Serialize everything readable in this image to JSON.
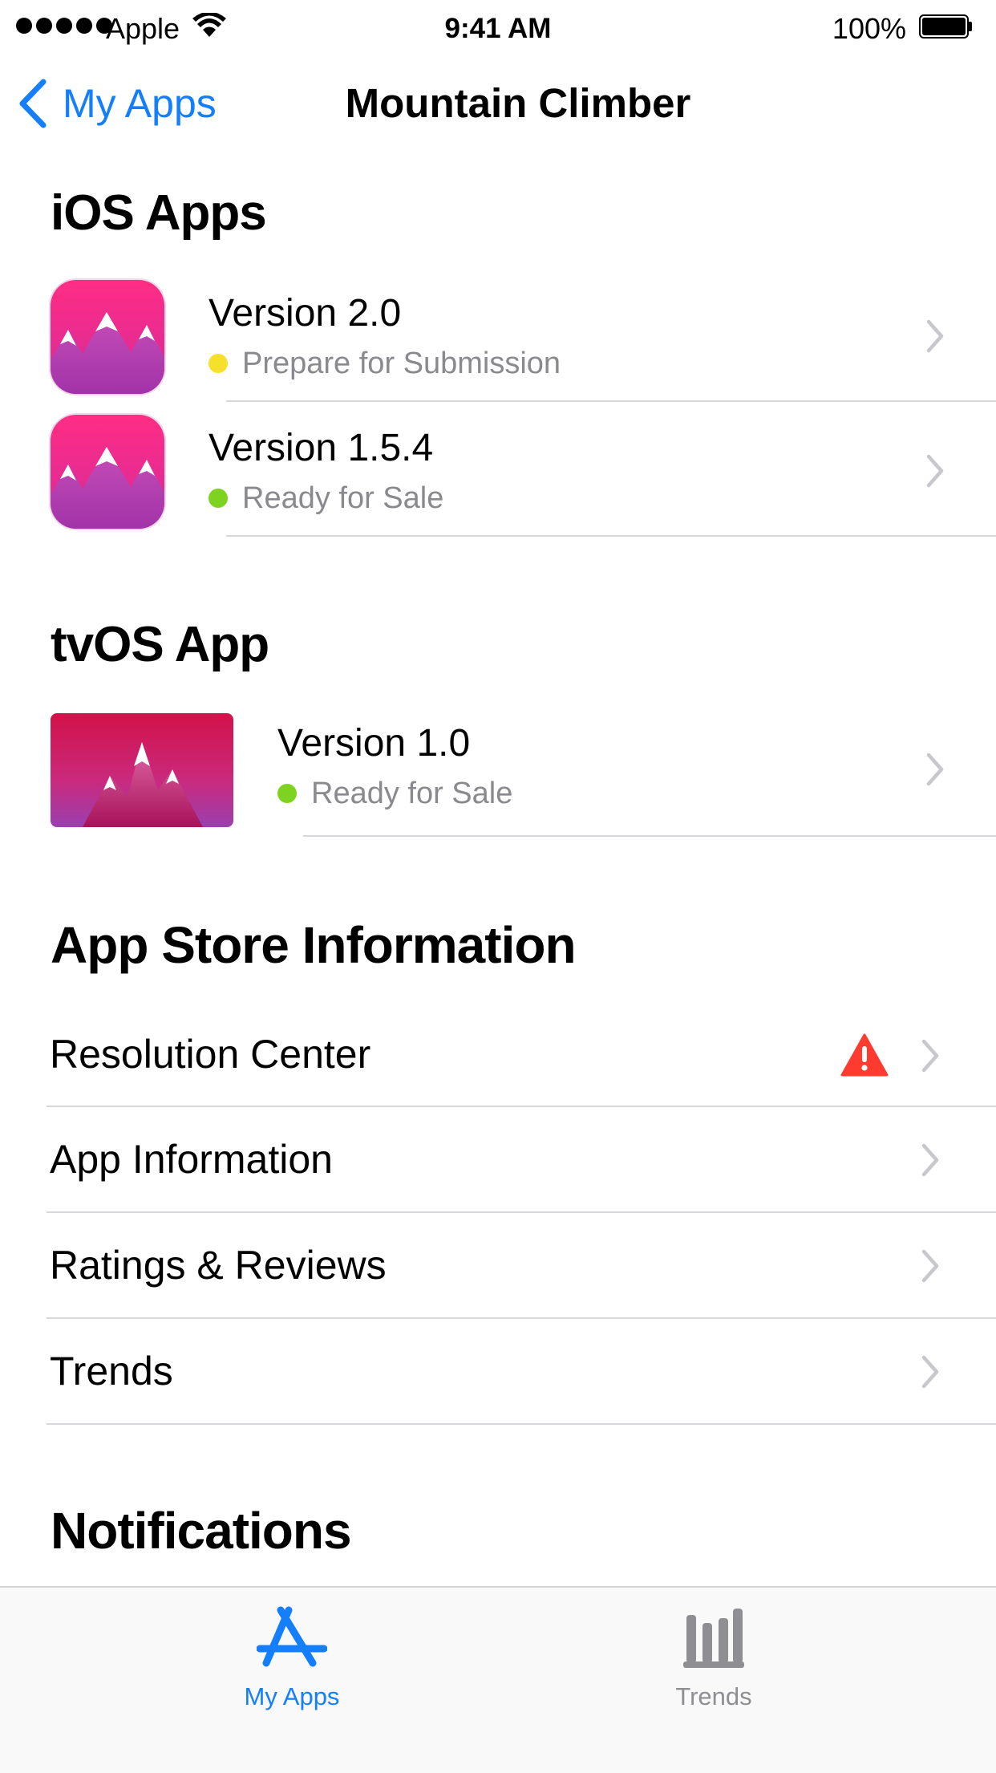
{
  "status_bar": {
    "carrier": "Apple",
    "time": "9:41 AM",
    "battery": "100%",
    "signal_icon": "signal-dots-icon",
    "wifi_icon": "wifi-icon",
    "battery_icon": "battery-icon"
  },
  "nav": {
    "back_label": "My Apps",
    "title": "Mountain Climber",
    "accent_color": "#147efb"
  },
  "ios_section": {
    "heading": "iOS Apps",
    "items": [
      {
        "version": "Version 2.0",
        "status": "Prepare for Submission",
        "status_color": "#f7e02b"
      },
      {
        "version": "Version 1.5.4",
        "status": "Ready for Sale",
        "status_color": "#7ed321"
      }
    ]
  },
  "tvos_section": {
    "heading": "tvOS App",
    "items": [
      {
        "version": "Version 1.0",
        "status": "Ready for Sale",
        "status_color": "#7ed321"
      }
    ]
  },
  "store_section": {
    "heading": "App Store Information",
    "items": [
      {
        "label": "Resolution Center",
        "alert": true,
        "alert_icon": "warning-icon",
        "alert_color": "#ff3b30"
      },
      {
        "label": "App Information"
      },
      {
        "label": "Ratings & Reviews"
      },
      {
        "label": "Trends"
      }
    ]
  },
  "notifications_section": {
    "heading": "Notifications"
  },
  "tabbar": {
    "tabs": [
      {
        "label": "My Apps",
        "icon": "app-store-icon",
        "active": true,
        "color": "#147efb"
      },
      {
        "label": "Trends",
        "icon": "bar-chart-icon",
        "active": false,
        "color": "#8e8e93"
      }
    ]
  }
}
